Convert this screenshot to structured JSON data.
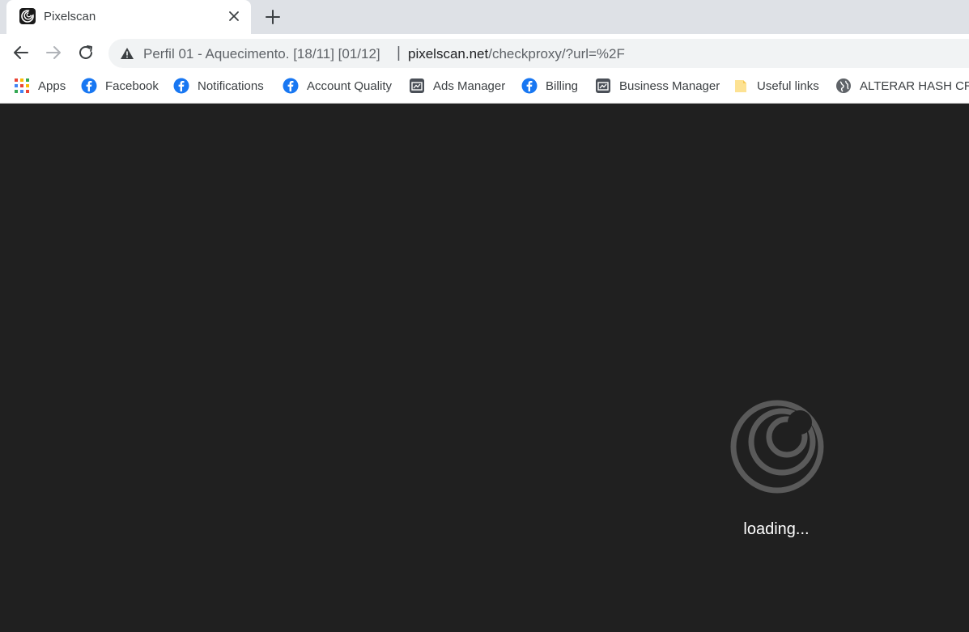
{
  "tab": {
    "title": "Pixelscan",
    "favicon": "pixelscan-logo-icon",
    "close_icon": "close-icon"
  },
  "new_tab_icon": "plus-icon",
  "toolbar": {
    "back_icon": "arrow-left-icon",
    "forward_icon": "arrow-right-icon",
    "reload_icon": "reload-icon"
  },
  "omnibox": {
    "security_icon": "warning-icon",
    "profile_label": "Perfil 01 - Aquecimento. [18/11] [01/12]",
    "separator": "|",
    "url_host": "pixelscan.net",
    "url_path": "/checkproxy/?url=%2F"
  },
  "bookmarks": [
    {
      "label": "Apps",
      "icon": "apps-grid-icon"
    },
    {
      "label": "Facebook",
      "icon": "facebook-icon"
    },
    {
      "label": "Notifications",
      "icon": "facebook-icon"
    },
    {
      "label": "Account Quality",
      "icon": "facebook-icon"
    },
    {
      "label": "Ads Manager",
      "icon": "ads-manager-icon"
    },
    {
      "label": "Billing",
      "icon": "facebook-icon"
    },
    {
      "label": "Business Manager",
      "icon": "ads-manager-icon"
    },
    {
      "label": "Useful links",
      "icon": "folder-icon"
    },
    {
      "label": "ALTERAR HASH CRI...",
      "icon": "globe-icon"
    }
  ],
  "content": {
    "background": "#202020",
    "loader_icon": "pixelscan-logo-icon",
    "loading_text": "loading..."
  },
  "colors": {
    "tabstrip": "#dee1e6",
    "facebook_blue": "#1877f2",
    "logo_gray": "#5a5a5a"
  }
}
